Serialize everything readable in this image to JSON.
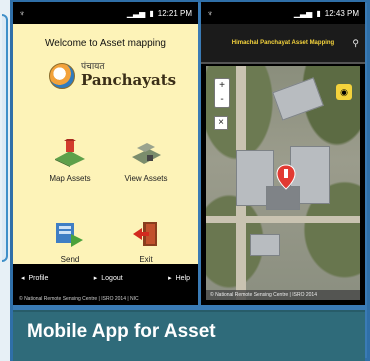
{
  "phone1": {
    "status_time": "12:21 PM",
    "welcome": "Welcome to Asset mapping",
    "brand_hindi": "पंचायत",
    "brand_main": "Panchayats",
    "tiles": [
      {
        "label": "Map Assets",
        "icon": "map-assets-icon"
      },
      {
        "label": "View Assets",
        "icon": "view-assets-icon"
      },
      {
        "label": "Send",
        "icon": "send-icon"
      },
      {
        "label": "Exit",
        "icon": "exit-icon"
      }
    ],
    "bottom_bar": [
      "Profile",
      "Logout",
      "Help"
    ],
    "footer": "© National Remote Sensing Centre | ISRO 2014 | NIC"
  },
  "phone2": {
    "status_time": "12:43 PM",
    "title": "Himachal Panchayat Asset Mapping",
    "search_icon": "search-icon",
    "zoom_in": "+",
    "zoom_out": "-",
    "close": "×",
    "attribution": "© National Remote Sensing Centre | ISRO 2014"
  },
  "caption": "Mobile App for Asset"
}
